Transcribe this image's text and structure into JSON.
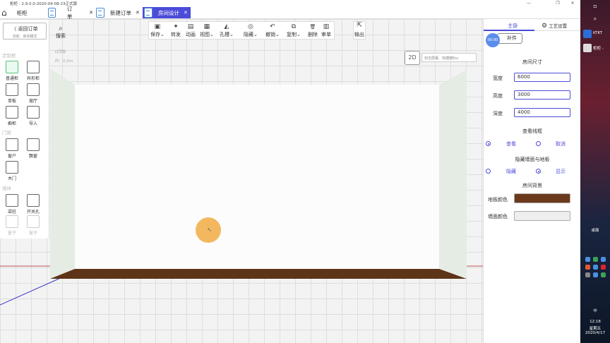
{
  "window": {
    "title": "柜柜 - 2.9.0.0-2020-04-08-23正式版",
    "min": "—",
    "max": "❐",
    "close": "✕"
  },
  "tabs": [
    {
      "label": "柜柜"
    },
    {
      "label": "订单"
    },
    {
      "label": "新建订单"
    },
    {
      "label": "房间设计"
    }
  ],
  "tab_close": "✕",
  "left": {
    "back": "返回订单",
    "back_sub": "当前：房间模式",
    "sections": [
      "定制柜",
      "门窗",
      "墙体"
    ],
    "tools": [
      "普通柜",
      "异形柜",
      "单板",
      "搜厅",
      "橱柜",
      "导入",
      "窗户",
      "飘窗",
      "木门",
      "梁柱",
      "开关孔",
      "窗子",
      "窗子"
    ]
  },
  "search": {
    "label": "搜索"
  },
  "hint": {
    "line1": "Ω顶板",
    "line2": "约：0.0m"
  },
  "toolbar": [
    {
      "label": "保存",
      "icon": "▣",
      "dd": "⌄"
    },
    {
      "label": "转发",
      "icon": "✦"
    },
    {
      "label": "动画",
      "icon": "▤"
    },
    {
      "label": "视图",
      "icon": "▦",
      "dd": "⌄"
    },
    {
      "label": "孔槽",
      "icon": "◭",
      "dd": "⌄"
    },
    {
      "label": "隐藏",
      "icon": "◎",
      "dd": "⌄"
    },
    {
      "label": "撤销",
      "icon": "↶",
      "dd": "⌄"
    },
    {
      "label": "复制",
      "icon": "⧉",
      "dd": "⌄"
    },
    {
      "label": "删除",
      "icon": "🗑"
    },
    {
      "label": "审单",
      "icon": "▥"
    }
  ],
  "output": {
    "label": "输出",
    "icon": "⇱"
  },
  "view2d": "2D",
  "tip": "双击屏幕、快捷键Esc",
  "right": {
    "tab_main": "主卧",
    "tab_craft": "工艺设置",
    "gear": "⚙",
    "patch": "补件",
    "recording": "00:00",
    "room_size": "房间尺寸",
    "fields": [
      {
        "label": "宽度",
        "value": "6000"
      },
      {
        "label": "高度",
        "value": "3000"
      },
      {
        "label": "深度",
        "value": "4000"
      }
    ],
    "view_frame": "查看线框",
    "view": "查看",
    "cancel": "取消",
    "hide_wall": "隐藏墙面与地板",
    "hide": "隐藏",
    "show": "显示",
    "background": "房间背景",
    "floor_color": "地板颜色",
    "wall_color": "墙面颜色"
  },
  "colors": {
    "accent": "#4b4cd8",
    "floor": "#6b3a1c",
    "wall": "#eeeeee"
  },
  "taskbar": {
    "app1": "KTKT",
    "app2": "柜柜 -",
    "desktop": "桌面",
    "ime": "中",
    "time": "12:18",
    "weekday": "星期五",
    "date": "2020/4/17"
  }
}
